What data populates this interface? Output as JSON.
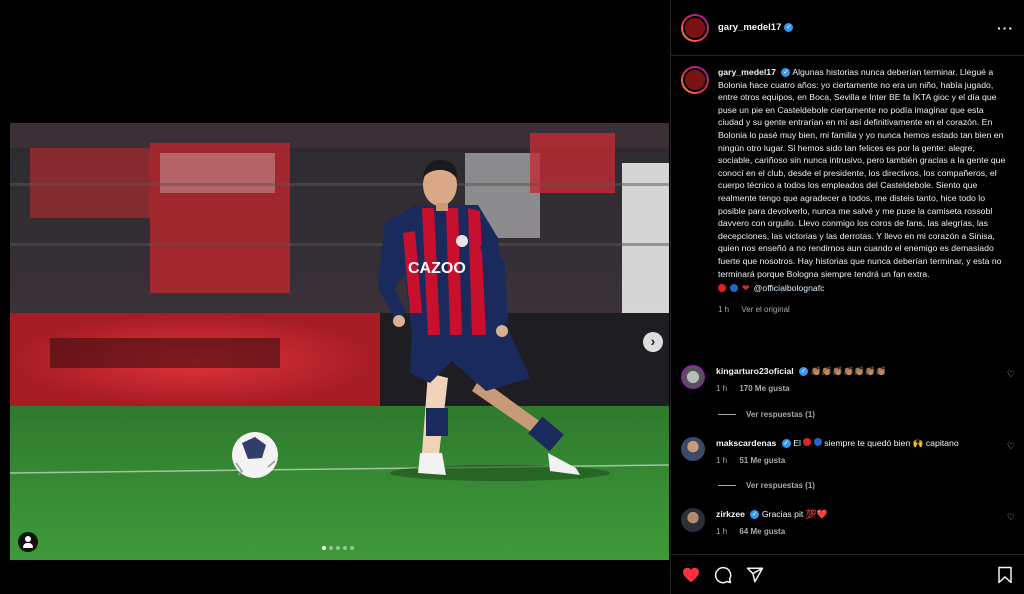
{
  "post": {
    "author": "gary_medel17",
    "caption_text": "Algunas historias nunca deberían terminar. Llegué a Bolonia hace cuatro años: yo ciertamente no era un niño, había jugado, entre otros equipos, en Boca, Sevilla e Inter BE fa ÍKTA gioc y el día que puse un pie en Casteldebole ciertamente no podía imaginar que esta ciudad y su gente entrarían en mí así definitivamente en el corazón. En Bolonia lo pasé muy bien, mi familia y yo nunca hemos estado tan bien en ningún otro lugar. Si hemos sido tan felices es por la gente: alegre, sociable, cariñoso sin nunca intrusivo, pero también gracias a la gente que conocí en el club, desde el presidente, los directivos, los compañeros, el cuerpo técnico a todos los empleados del Casteldebole. Siento que realmente tengo que agradecer a todos, me disteis tanto, hice todo lo posible para devolverlo, nunca me salvé y me puse la camiseta rossobl davvero con orgullo. Llevo conmigo los coros de fans, las alegrías, las decepciones, las victorias y las derrotas. Y llevo en mi corazón a Sinisa, quien nos enseñó a no rendirnos aun cuando el enemigo es demasiado fuerte que nosotros. Hay historias que nunca deberían terminar, y esta no terminará porque Bologna siempre tendrá un fan extra.",
    "mention": "@officialbolognafc",
    "time": "1 h",
    "see_original": "Ver el original",
    "sponsor_text": "CAZOO"
  },
  "comments": [
    {
      "user": "kingarturo23oficial",
      "text": "👏🏽👏🏽👏🏽👏🏽👏🏽👏🏽👏🏽",
      "time": "1 h",
      "likes": "170 Me gusta",
      "replies": "Ver respuestas (1)"
    },
    {
      "user": "makscardenas",
      "text_before": "El",
      "text_after": "siempre te quedó bien 🙌 capitano",
      "time": "1 h",
      "likes": "51 Me gusta",
      "replies": "Ver respuestas (1)"
    },
    {
      "user": "zirkzee",
      "text": "Gracias pit 💯❤️",
      "time": "1 h",
      "likes": "64 Me gusta"
    }
  ],
  "icons": {
    "more": "more-options-icon",
    "verified": "verified-badge-icon",
    "like": "heart-filled-icon",
    "comment": "comment-icon",
    "share": "share-icon",
    "save": "bookmark-icon",
    "next": "chevron-right-icon",
    "tag": "user-tag-icon"
  },
  "colors": {
    "accent_blue": "#3897f0",
    "like_red": "#ff3040",
    "bologna_red": "#c8102e",
    "bologna_navy": "#1b2a5c"
  },
  "glyphs": {
    "more": "···",
    "verified": "✓",
    "next": "›",
    "heart_small": "♡",
    "heart_emoji": "❤"
  }
}
